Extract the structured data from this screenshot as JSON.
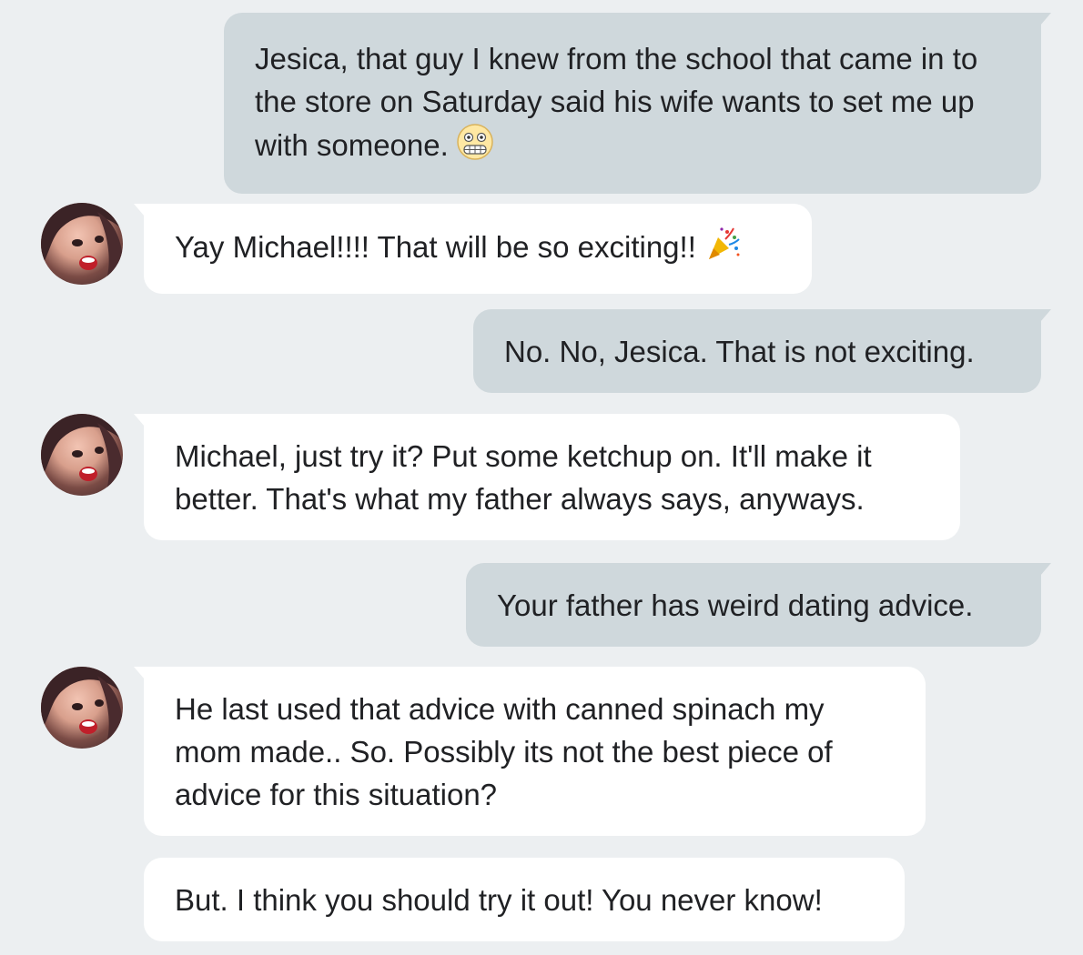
{
  "conversation": {
    "messages": [
      {
        "direction": "outgoing",
        "text": "Jesica, that guy I knew from the school that came in to the store on Saturday said his wife wants to set me up with someone.",
        "emoji": "grimacing-face"
      },
      {
        "direction": "incoming",
        "text": "Yay Michael!!!! That will be so exciting!!",
        "emoji": "party-popper"
      },
      {
        "direction": "outgoing",
        "text": "No. No, Jesica. That is not exciting."
      },
      {
        "direction": "incoming",
        "text": "Michael, just try it? Put some ketchup on. It'll make it better. That's what my father always says, anyways."
      },
      {
        "direction": "outgoing",
        "text": "Your father has weird dating advice."
      },
      {
        "direction": "incoming",
        "text": "He last used that advice with canned spinach my mom made.. So. Possibly its not the best piece of advice for this situation?"
      },
      {
        "direction": "incoming",
        "text": "But. I think you should try it out! You never know!"
      }
    ]
  },
  "colors": {
    "background": "#eceff1",
    "outgoing_bubble": "#cfd8dc",
    "incoming_bubble": "#ffffff",
    "text": "#202124"
  }
}
